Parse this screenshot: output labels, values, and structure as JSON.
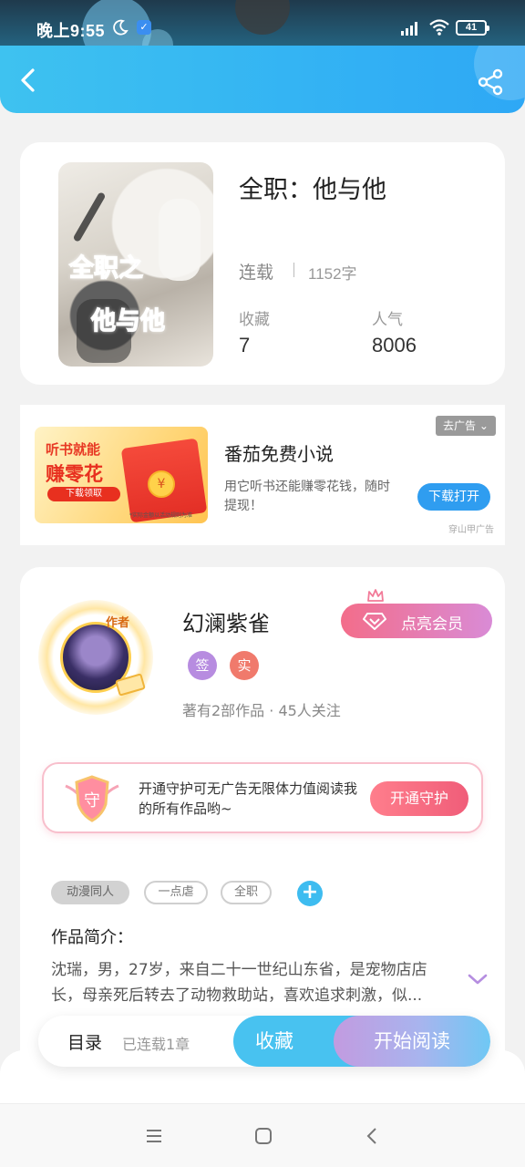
{
  "status_bar": {
    "time": "晚上9:55",
    "battery": "41"
  },
  "book": {
    "title": "全职：他与他",
    "cover_text_1": "全职之",
    "cover_text_2": "他与他",
    "status": "连载",
    "word_count": "1152字",
    "favorites_label": "收藏",
    "favorites_value": "7",
    "popularity_label": "人气",
    "popularity_value": "8006"
  },
  "ad": {
    "image_line1": "听书就能",
    "image_line2": "赚零花",
    "image_button": "下载领取",
    "image_footnote": "*实际金额以活动规则为准",
    "close_label": "去广告",
    "title": "番茄免费小说",
    "description": "用它听书还能赚零花钱，随时提现！",
    "download_label": "下载打开",
    "source": "穿山甲广告"
  },
  "author": {
    "avatar_tag": "作者",
    "name": "幻澜紫雀",
    "badge_signed": "签",
    "badge_real": "实",
    "stats": "著有2部作品 · 45人关注",
    "vip_label": "点亮会员"
  },
  "guard": {
    "icon_text": "守",
    "text": "开通守护可无广告无限体力值阅读我的所有作品哟~",
    "button": "开通守护"
  },
  "tags": [
    "动漫同人",
    "一点虐",
    "全职"
  ],
  "tag_add": "+",
  "intro": {
    "title": "作品简介：",
    "text": "沈瑞，男，27岁，来自二十一世纪山东省，是宠物店店长，母亲死后转去了动物救助站，喜欢追求刺激，似..."
  },
  "action_bar": {
    "toc_label": "目录",
    "toc_sub": "已连载1章",
    "favorite_button": "收藏",
    "read_button": "开始阅读"
  },
  "colors": {
    "accent_blue": "#34b4f3",
    "pink": "#f36d8a",
    "purple": "#c29be0"
  }
}
